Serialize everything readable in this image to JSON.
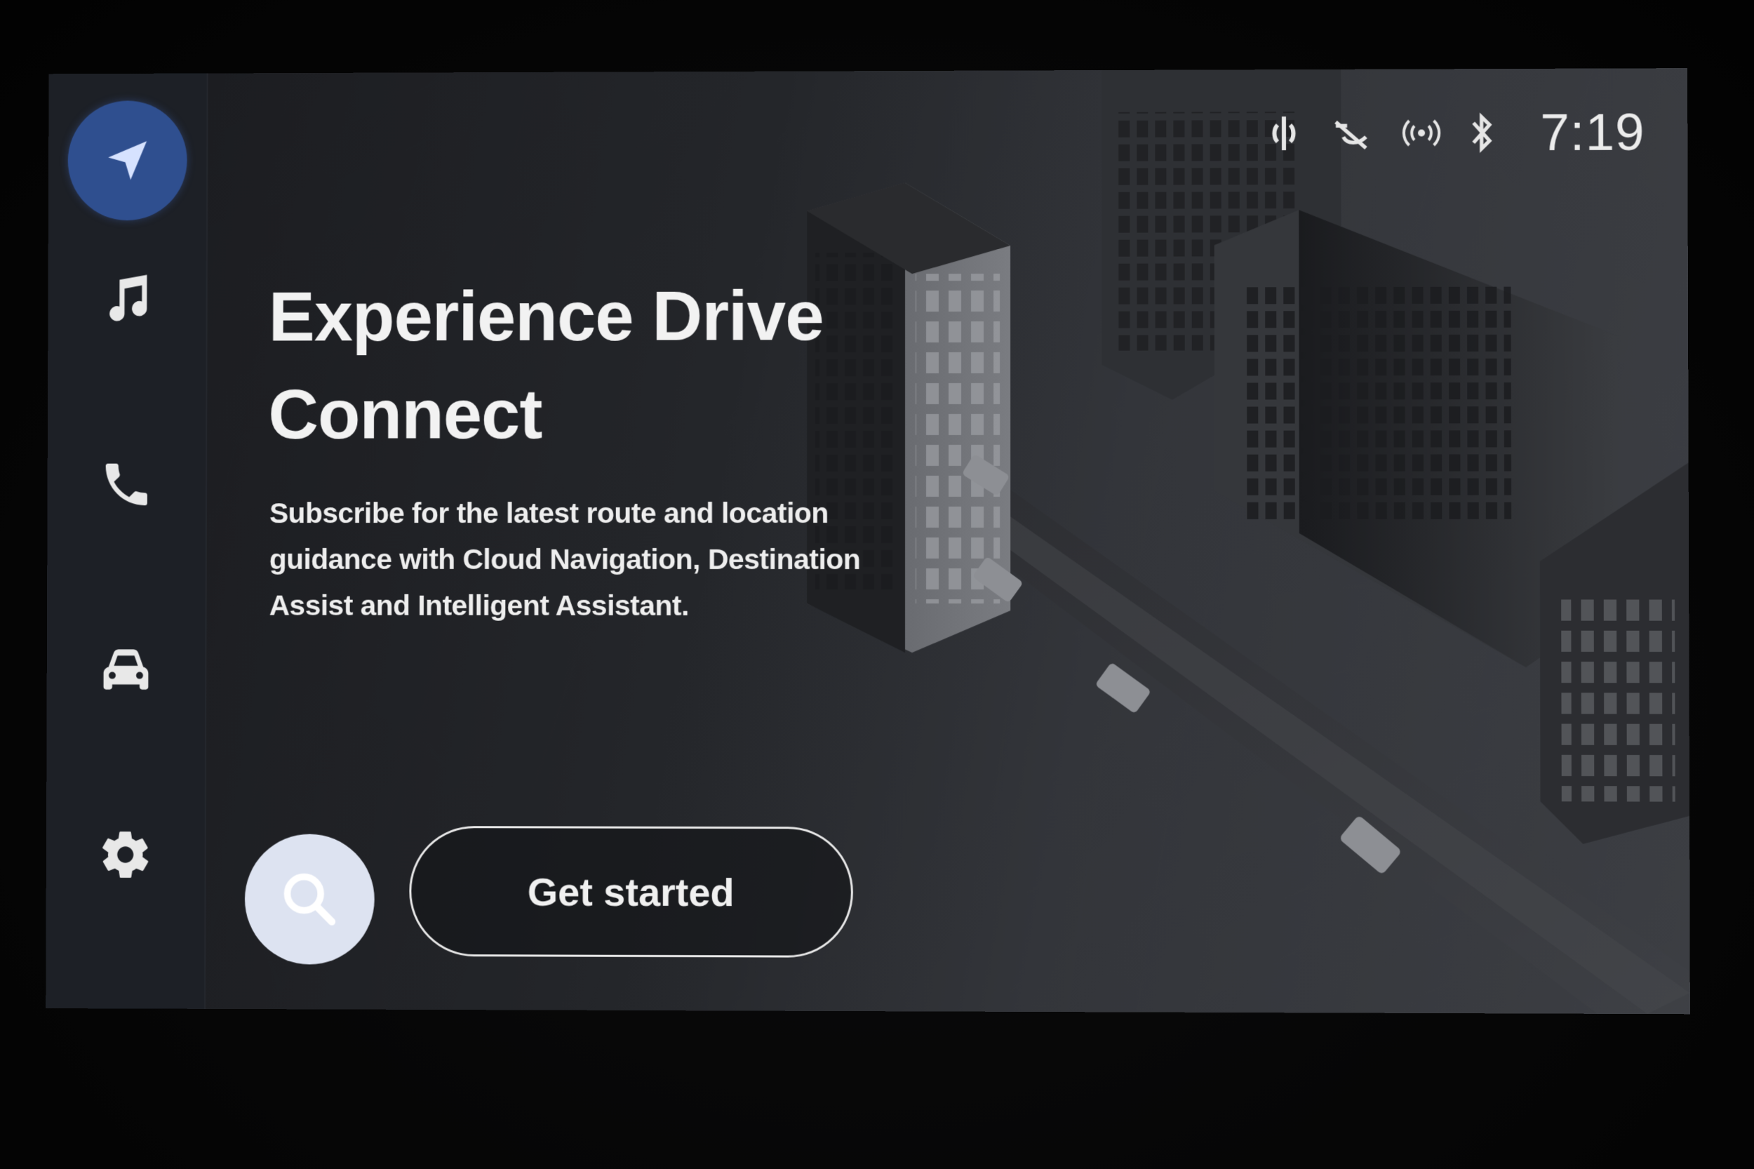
{
  "sidebar": {
    "items": [
      {
        "name": "navigation",
        "icon": "navigation-arrow-icon",
        "active": true
      },
      {
        "name": "music",
        "icon": "music-note-icon",
        "active": false
      },
      {
        "name": "phone",
        "icon": "phone-icon",
        "active": false
      },
      {
        "name": "vehicle",
        "icon": "car-icon",
        "active": false
      },
      {
        "name": "settings",
        "icon": "gear-icon",
        "active": false
      }
    ]
  },
  "status_bar": {
    "icons": [
      "wireless-charging-icon",
      "mic-muted-icon",
      "wireless-signal-icon",
      "bluetooth-icon"
    ],
    "time": "7:19"
  },
  "main": {
    "title": "Experience Drive Connect",
    "subtitle": "Subscribe for the latest route and location guidance with Cloud Navigation, Destination Assist and Intelligent Assistant.",
    "search_icon": "search-icon",
    "cta_label": "Get started"
  },
  "colors": {
    "accent": "#2f4f8f",
    "sidebar_bg": "#1d2026",
    "search_button_bg": "#dde3f1",
    "text": "#f2f2f2"
  }
}
